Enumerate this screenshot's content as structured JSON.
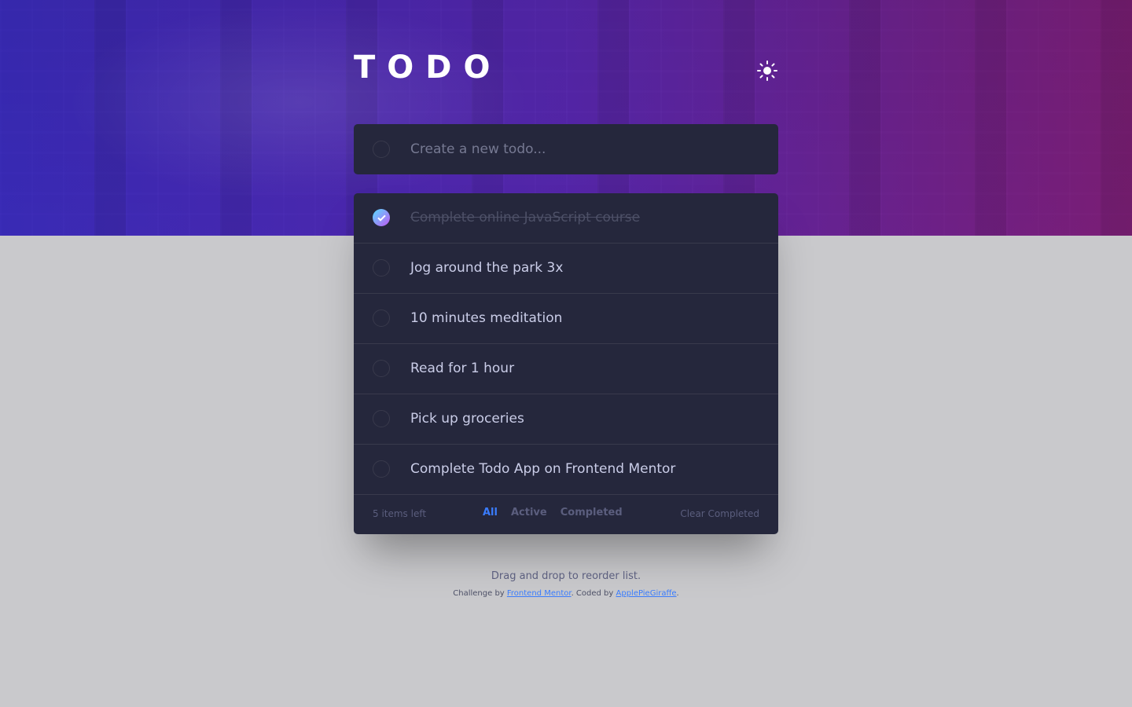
{
  "header": {
    "title": "TODO",
    "theme_toggle_icon": "sun-icon"
  },
  "new_todo": {
    "placeholder": "Create a new todo..."
  },
  "todos": [
    {
      "text": "Complete online JavaScript course",
      "completed": true
    },
    {
      "text": "Jog around the park 3x",
      "completed": false
    },
    {
      "text": "10 minutes meditation",
      "completed": false
    },
    {
      "text": "Read for 1 hour",
      "completed": false
    },
    {
      "text": "Pick up groceries",
      "completed": false
    },
    {
      "text": "Complete Todo App on Frontend Mentor",
      "completed": false
    }
  ],
  "footer": {
    "items_left": "5 items left",
    "filters": {
      "all": "All",
      "active": "Active",
      "completed": "Completed"
    },
    "active_filter": "All",
    "clear": "Clear Completed"
  },
  "hint": "Drag and drop to reorder list.",
  "attribution": {
    "prefix": "Challenge by ",
    "link1": "Frontend Mentor",
    "middle": ". Coded by ",
    "link2": "ApplePieGiraffe",
    "suffix": "."
  },
  "colors": {
    "accent": "#3a7cfd",
    "panel": "#25273c",
    "check_gradient_start": "#57ddff",
    "check_gradient_end": "#c058f3",
    "page_background": "#c9c9cc"
  }
}
